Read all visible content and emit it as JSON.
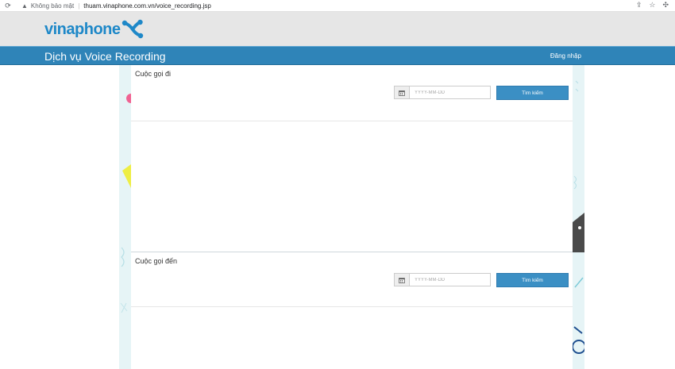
{
  "browser": {
    "security_label": "Không bảo mật",
    "url": "thuam.vinaphone.com.vn/voice_recording.jsp"
  },
  "header": {
    "logo_text": "vinaphone",
    "brand_color": "#1e88c8"
  },
  "title_band": {
    "title": "Dịch vụ Voice Recording",
    "login_label": "Đăng nhập",
    "band_color": "#2f84b8"
  },
  "outgoing": {
    "title": "Cuộc gọi đi",
    "date_placeholder": "YYYY-MM-DD",
    "search_label": "Tìm kiếm"
  },
  "incoming": {
    "title": "Cuộc gọi đến",
    "date_placeholder": "YYYY-MM-DD",
    "search_label": "Tìm kiếm"
  },
  "icons": {
    "reload": "reload-icon",
    "warning": "warning-icon",
    "share": "share-icon",
    "star": "star-icon",
    "extensions": "extensions-icon",
    "calendar": "calendar-icon"
  }
}
